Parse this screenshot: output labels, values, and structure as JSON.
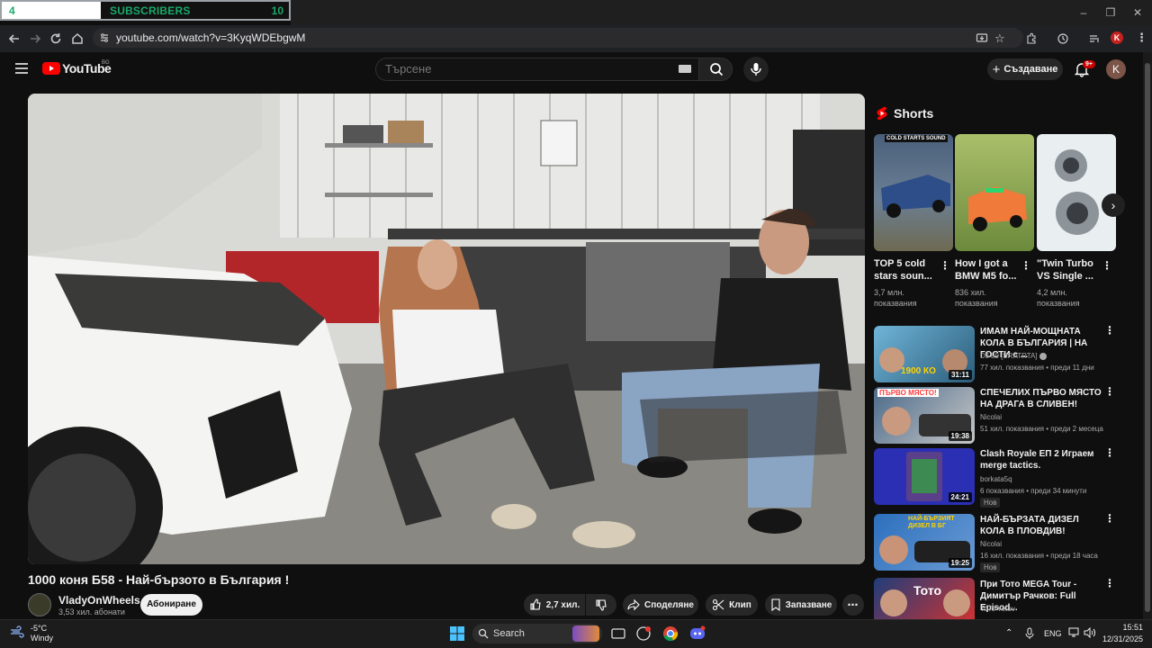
{
  "overlay": {
    "left": "4",
    "label": "SUBSCRIBERS",
    "right": "10"
  },
  "browser": {
    "url": "youtube.com/watch?v=3KyqWDEbgwM",
    "profile_initial": "K"
  },
  "header": {
    "logo_text": "YouTube",
    "region": "BG",
    "search_placeholder": "Търсене",
    "create_label": "Създаване",
    "notif_badge": "9+",
    "avatar_initial": "K"
  },
  "video": {
    "title": "1000 коня Б58 - Най-бързото в България !",
    "channel": "VladyOnWheels",
    "subscribers": "3,53 хил. абонати",
    "subscribe_label": "Абониране",
    "likes": "2,7 хил.",
    "share_label": "Споделяне",
    "clip_label": "Клип",
    "save_label": "Запазване"
  },
  "shorts": {
    "section_title": "Shorts",
    "items": [
      {
        "title": "TOP 5 cold stars soun...",
        "views": "3,7 млн. показвания",
        "overlay": "COLD STARTS SOUND"
      },
      {
        "title": "How I got a BMW M5 fo...",
        "views": "836 хил. показвания",
        "overlay": ""
      },
      {
        "title": "\"Twin Turbo VS Single ...",
        "views": "4,2 млн. показвания",
        "overlay": ""
      }
    ]
  },
  "related": [
    {
      "title": "ИМАМ НАЙ-МОЩНАТА КОЛА В БЪЛГАРИЯ | НА ГОСТИ с ...",
      "channel": "DJ 89 [BRATRTA]",
      "meta": "77 хил. показвания • преди 11 дни",
      "duration": "31:11",
      "badge": "",
      "thumb_text": "1900 КО"
    },
    {
      "title": "СПЕЧЕЛИХ ПЪРВО МЯСТО НА ДРАГА В СЛИВЕН!",
      "channel": "Nicolai",
      "meta": "51 хил. показвания • преди 2 месеца",
      "duration": "19:38",
      "badge": "",
      "thumb_text": "ПЪРВО МЯСТО!"
    },
    {
      "title": "Clash Royale ЕП 2 Играем merge tactics.",
      "channel": "borkata5q",
      "meta": "6 показвания • преди 34 минути",
      "duration": "24:21",
      "badge": "Нов",
      "thumb_text": ""
    },
    {
      "title": "НАЙ-БЪРЗАТА ДИЗЕЛ КОЛА В ПЛОВДИВ!",
      "channel": "Nicolai",
      "meta": "16 хил. показвания • преди 18 часа",
      "duration": "19:25",
      "badge": "Нов",
      "thumb_text": "НАЙ-БЪРЗИЯТ ДИЗЕЛ В БГ"
    },
    {
      "title": "При Тото MEGA Tour - Димитър Рачков: Full Episod...",
      "channel": "ToTo Yotov",
      "meta": "",
      "duration": "",
      "badge": "",
      "thumb_text": "Тото"
    }
  ],
  "taskbar": {
    "temp": "-5°C",
    "weather": "Windy",
    "search_label": "Search",
    "lang": "ENG",
    "time": "15:51",
    "date": "12/31/2025"
  },
  "colors": {
    "yt_red": "#ff0000",
    "bg": "#0f0f0f",
    "accent_green": "#1aa86a"
  }
}
